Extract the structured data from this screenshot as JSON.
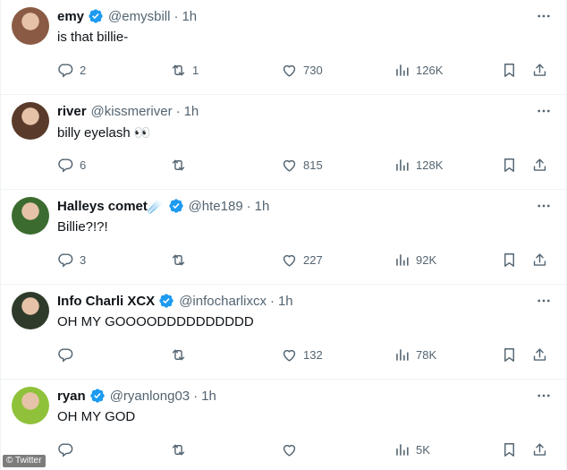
{
  "tweets": [
    {
      "name": "emy",
      "verified": true,
      "handle": "@emysbill",
      "dot": "·",
      "time": "1h",
      "text": "is that billie-",
      "reply_count": "2",
      "retweet_count": "1",
      "like_count": "730",
      "view_count": "126K",
      "avatar_color": "#8a5a44"
    },
    {
      "name": "river",
      "verified": false,
      "handle": "@kissmeriver",
      "dot": "·",
      "time": "1h",
      "text": "billy eyelash 👀",
      "reply_count": "6",
      "retweet_count": "",
      "like_count": "815",
      "view_count": "128K",
      "avatar_color": "#5a3a2a"
    },
    {
      "name": "Halleys comet☄️",
      "verified": true,
      "handle": "@hte189",
      "dot": "·",
      "time": "1h",
      "text": "Billie?!?!",
      "reply_count": "3",
      "retweet_count": "",
      "like_count": "227",
      "view_count": "92K",
      "avatar_color": "#3c6b2f"
    },
    {
      "name": "Info Charli XCX",
      "verified": true,
      "handle": "@infocharlixcx",
      "dot": "·",
      "time": "1h",
      "text": "OH MY GOOOODDDDDDDDDD",
      "reply_count": "",
      "retweet_count": "",
      "like_count": "132",
      "view_count": "78K",
      "avatar_color": "#2f3b2a"
    },
    {
      "name": "ryan",
      "verified": true,
      "handle": "@ryanlong03",
      "dot": "·",
      "time": "1h",
      "text": "OH MY GOD",
      "reply_count": "",
      "retweet_count": "",
      "like_count": "",
      "view_count": "5K",
      "avatar_color": "#8fc23a"
    }
  ],
  "watermark": "© Twitter",
  "colors": {
    "verified_blue": "#1d9bf0",
    "secondary_text": "#536471",
    "divider": "#eff3f4"
  }
}
